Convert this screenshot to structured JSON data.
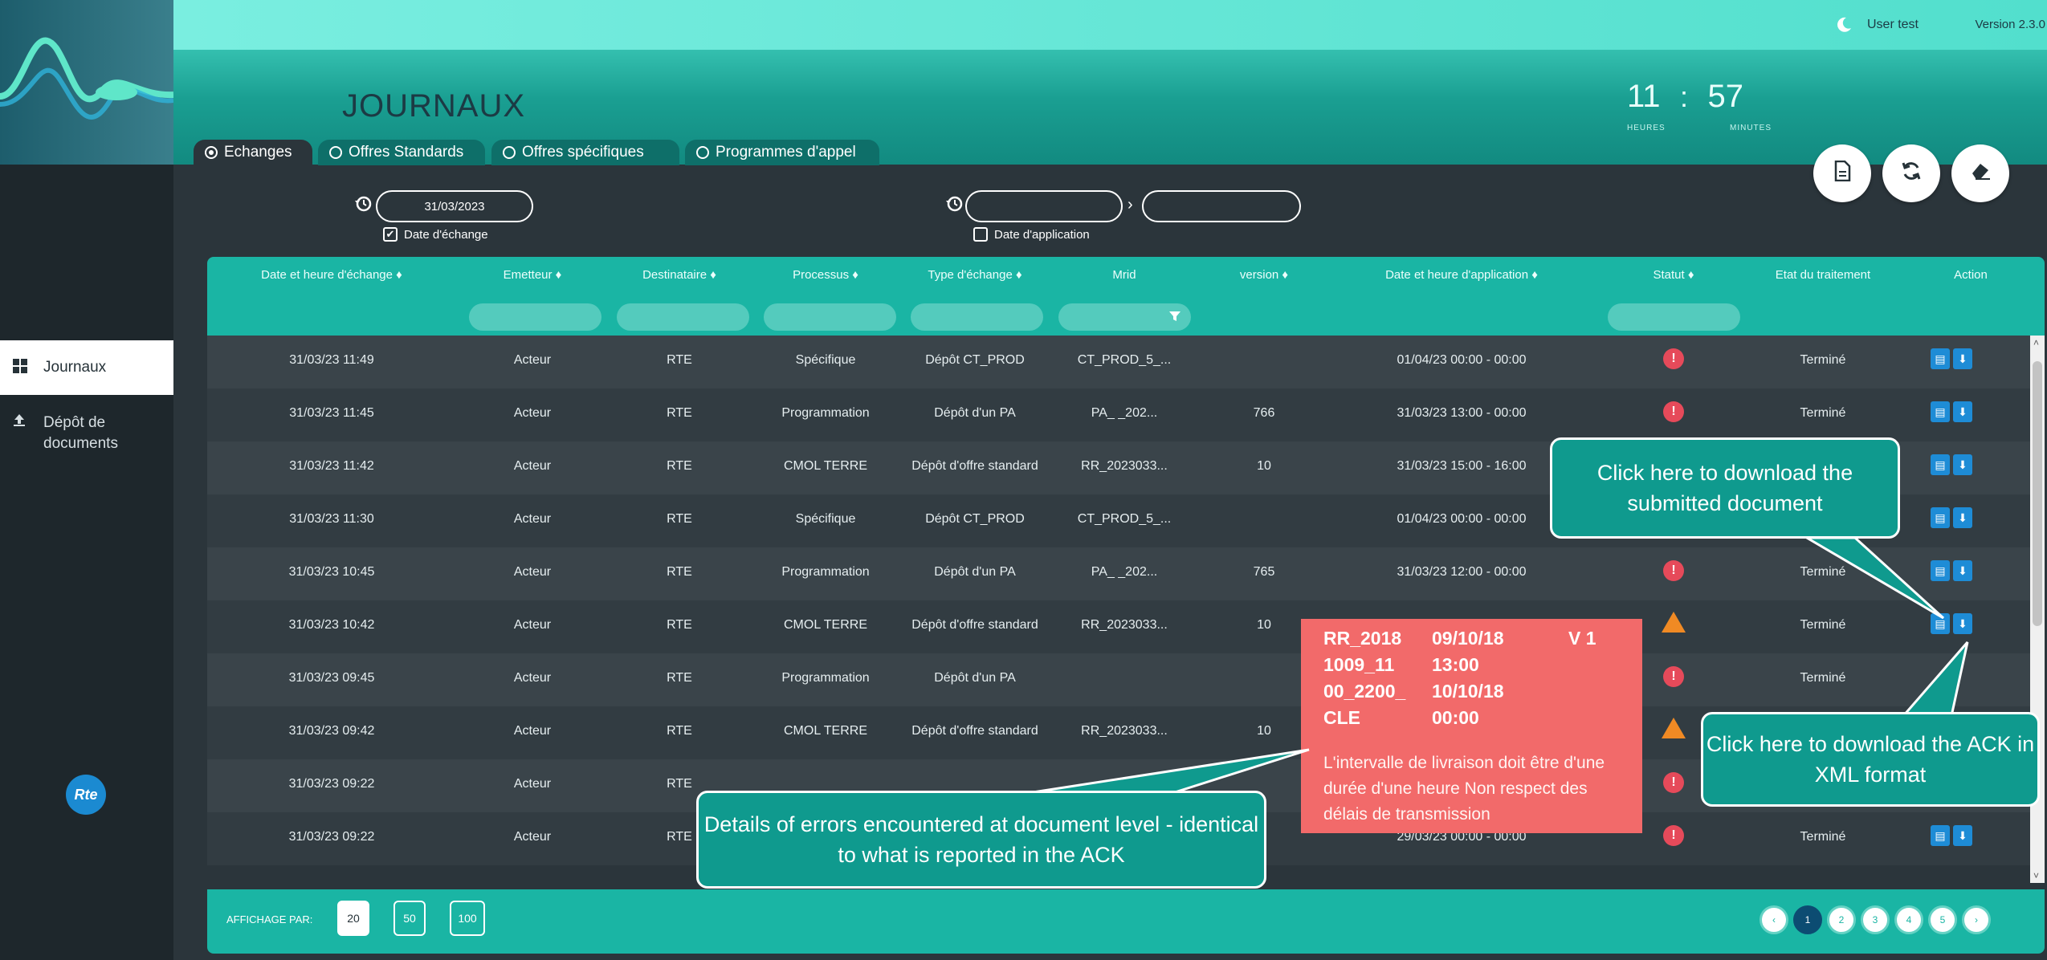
{
  "header": {
    "user": "User test",
    "version": "Version 2.3.0",
    "title": "JOURNAUX",
    "clock": {
      "hours": "11",
      "sep": ":",
      "minutes": "57",
      "hours_label": "HEURES",
      "minutes_label": "MINUTES"
    }
  },
  "tabs": [
    {
      "label": "Echanges",
      "active": true
    },
    {
      "label": "Offres Standards",
      "active": false
    },
    {
      "label": "Offres spécifiques",
      "active": false
    },
    {
      "label": "Programmes d'appel",
      "active": false
    }
  ],
  "header_actions": [
    "document-icon",
    "refresh-icon",
    "eraser-icon"
  ],
  "sidebar": {
    "items": [
      {
        "label": "Journaux",
        "icon": "grid-icon",
        "active": true
      },
      {
        "label": "Dépôt de documents",
        "icon": "upload-icon",
        "active": false
      }
    ],
    "logo": "Rte"
  },
  "filters": {
    "exchange_date": "31/03/2023",
    "exchange_date_checkbox_label": "Date d'échange",
    "exchange_date_checked": true,
    "application_date_from": "",
    "application_date_to": "",
    "application_date_checkbox_label": "Date d'application",
    "application_date_checked": false
  },
  "table": {
    "columns": [
      "Date et heure d'échange",
      "Emetteur",
      "Destinataire",
      "Processus",
      "Type d'échange",
      "Mrid",
      "version",
      "Date et heure d'application",
      "Statut",
      "Etat du traitement",
      "Action"
    ],
    "rows": [
      {
        "date": "31/03/23 11:49",
        "emetteur": "Acteur",
        "destinataire": "RTE",
        "processus": "Spécifique",
        "type": "Dépôt CT_PROD",
        "mrid": "CT_PROD_5_...",
        "version": "",
        "application": "01/04/23 00:00 - 00:00",
        "statut": "error",
        "etat": "Terminé"
      },
      {
        "date": "31/03/23 11:45",
        "emetteur": "Acteur",
        "destinataire": "RTE",
        "processus": "Programmation",
        "type": "Dépôt d'un PA",
        "mrid": "PA_    _202...",
        "version": "766",
        "application": "31/03/23 13:00 - 00:00",
        "statut": "error",
        "etat": "Terminé"
      },
      {
        "date": "31/03/23 11:42",
        "emetteur": "Acteur",
        "destinataire": "RTE",
        "processus": "CMOL TERRE",
        "type": "Dépôt d'offre standard",
        "mrid": "RR_2023033...",
        "version": "10",
        "application": "31/03/23 15:00 - 16:00",
        "statut": "",
        "etat": ""
      },
      {
        "date": "31/03/23 11:30",
        "emetteur": "Acteur",
        "destinataire": "RTE",
        "processus": "Spécifique",
        "type": "Dépôt CT_PROD",
        "mrid": "CT_PROD_5_...",
        "version": "",
        "application": "01/04/23 00:00 - 00:00",
        "statut": "",
        "etat": ""
      },
      {
        "date": "31/03/23 10:45",
        "emetteur": "Acteur",
        "destinataire": "RTE",
        "processus": "Programmation",
        "type": "Dépôt d'un PA",
        "mrid": "PA_    _202...",
        "version": "765",
        "application": "31/03/23 12:00 - 00:00",
        "statut": "error",
        "etat": "Terminé"
      },
      {
        "date": "31/03/23 10:42",
        "emetteur": "Acteur",
        "destinataire": "RTE",
        "processus": "CMOL TERRE",
        "type": "Dépôt d'offre standard",
        "mrid": "RR_2023033...",
        "version": "10",
        "application": "",
        "statut": "warning",
        "etat": "Terminé"
      },
      {
        "date": "31/03/23 09:45",
        "emetteur": "Acteur",
        "destinataire": "RTE",
        "processus": "Programmation",
        "type": "Dépôt d'un PA",
        "mrid": "",
        "version": "",
        "application": "",
        "statut": "error",
        "etat": "Terminé"
      },
      {
        "date": "31/03/23 09:42",
        "emetteur": "Acteur",
        "destinataire": "RTE",
        "processus": "CMOL TERRE",
        "type": "Dépôt d'offre standard",
        "mrid": "RR_2023033...",
        "version": "10",
        "application": "",
        "statut": "warning",
        "etat": ""
      },
      {
        "date": "31/03/23 09:22",
        "emetteur": "Acteur",
        "destinataire": "RTE",
        "processus": "",
        "type": "",
        "mrid": "",
        "version": "",
        "application": "",
        "statut": "error",
        "etat": ""
      },
      {
        "date": "31/03/23 09:22",
        "emetteur": "Acteur",
        "destinataire": "RTE",
        "processus": "",
        "type": "",
        "mrid": "",
        "version": "",
        "application": "29/03/23 00:00 - 00:00",
        "statut": "error",
        "etat": "Terminé"
      }
    ]
  },
  "error_popup": {
    "cells": [
      "RR_2018",
      "09/10/18",
      "V 1",
      "1009_11",
      "13:00",
      "00_2200_",
      "10/10/18",
      "CLE",
      "00:00"
    ],
    "message": "L'intervalle de livraison doit être d'une durée d'une heure Non respect des délais de transmission"
  },
  "callouts": {
    "download_doc": "Click here to download the submitted document",
    "download_ack": "Click here to download the ACK in XML format",
    "error_details": "Details of errors encountered at document level - identical to what is reported in the ACK"
  },
  "footer": {
    "label": "AFFICHAGE PAR:",
    "page_sizes": [
      "20",
      "50",
      "100"
    ],
    "selected_page_size": "20",
    "pages": [
      "‹",
      "1",
      "2",
      "3",
      "4",
      "5",
      "›"
    ],
    "current_page": "1"
  },
  "colors": {
    "accent": "#1ab5a4",
    "error": "#e64a5a",
    "warning": "#f08a24",
    "action": "#1e8cd6",
    "popup": "#f26a6a",
    "callout": "#0f9a8e"
  }
}
